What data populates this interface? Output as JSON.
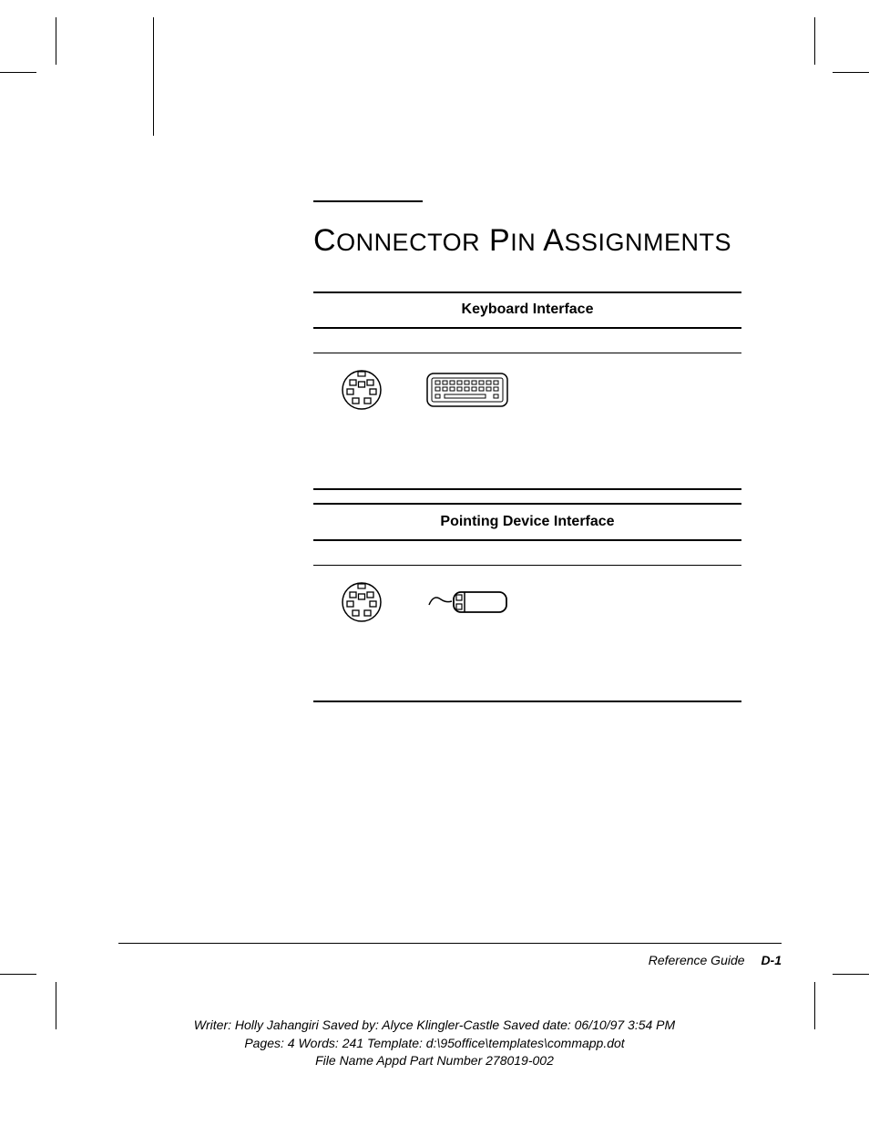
{
  "title": {
    "word1_cap": "C",
    "word1_rest": "ONNECTOR",
    "word2_cap": "P",
    "word2_rest": "IN",
    "word3_cap": "A",
    "word3_rest": "SSIGNMENTS"
  },
  "sections": [
    {
      "heading": "Keyboard Interface"
    },
    {
      "heading": "Pointing Device Interface"
    }
  ],
  "footer": {
    "guide": "Reference Guide",
    "page": "D-1"
  },
  "meta": {
    "line1": "Writer: Holly Jahangiri    Saved by: Alyce Klingler-Castle    Saved date: 06/10/97 3:54 PM",
    "line2": "Pages: 4    Words: 241    Template: d:\\95office\\templates\\commapp.dot",
    "line3": "File Name Appd    Part Number 278019-002"
  }
}
